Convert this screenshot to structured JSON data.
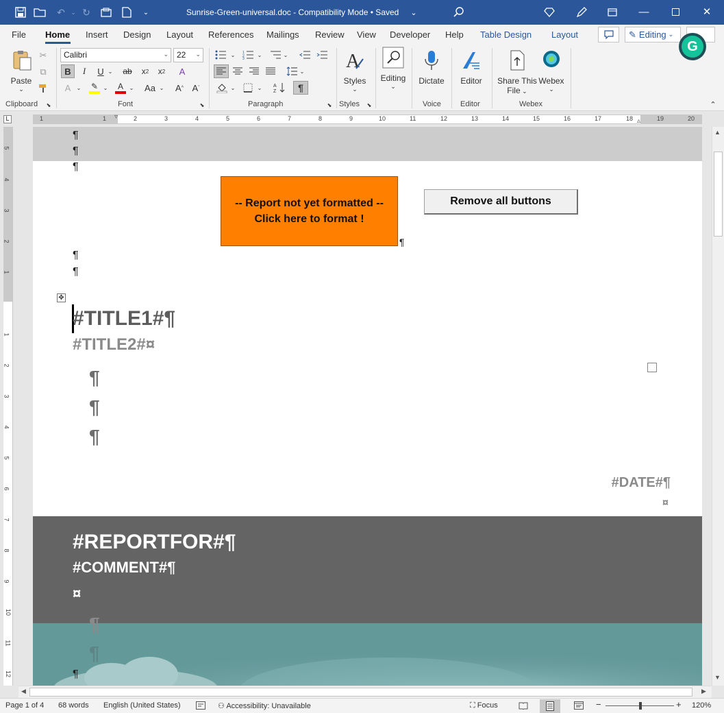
{
  "window": {
    "title": "Sunrise-Green-universal.doc  -  Compatibility Mode  •  Saved",
    "title_chevron": "⌄",
    "account_initial": "G"
  },
  "menu": {
    "file": "File",
    "home": "Home",
    "insert": "Insert",
    "design": "Design",
    "layout": "Layout",
    "references": "References",
    "mailings": "Mailings",
    "review": "Review",
    "view": "View",
    "developer": "Developer",
    "help": "Help",
    "table_design": "Table Design",
    "table_layout": "Layout",
    "editing_mode": "Editing"
  },
  "ribbon": {
    "paste": "Paste",
    "font_name": "Calibri",
    "font_size": "22",
    "styles": "Styles",
    "editing": "Editing",
    "dictate": "Dictate",
    "editor": "Editor",
    "share_line1": "Share This",
    "share_line2": "File",
    "webex": "Webex",
    "groups": {
      "clipboard": "Clipboard",
      "font": "Font",
      "paragraph": "Paragraph",
      "styles": "Styles",
      "voice": "Voice",
      "editor": "Editor",
      "webex": "Webex"
    }
  },
  "ruler": {
    "h_ticks": [
      "1",
      "1",
      "2",
      "3",
      "4",
      "5",
      "6",
      "7",
      "8",
      "9",
      "10",
      "11",
      "12",
      "13",
      "14",
      "15",
      "16",
      "17",
      "18",
      "19",
      "20"
    ],
    "v_ticks": [
      "5",
      "4",
      "3",
      "2",
      "1",
      "1",
      "2",
      "3",
      "4",
      "5",
      "6",
      "7",
      "8",
      "9",
      "10",
      "11",
      "12"
    ]
  },
  "document": {
    "pilcrow": "¶",
    "cell_end": "¤",
    "format_button_line1": "-- Report not yet formatted --",
    "format_button_line2": "Click here to format !",
    "remove_button": "Remove all buttons",
    "title1": "#TITLE1#¶",
    "title2": "#TITLE2#¤",
    "date": "#DATE#¶",
    "reportfor": "#REPORTFOR#¶",
    "comment": "#COMMENT#¶"
  },
  "status": {
    "page": "Page 1 of 4",
    "words": "68 words",
    "language": "English (United States)",
    "accessibility": "Accessibility: Unavailable",
    "focus": "Focus",
    "zoom": "120%"
  },
  "colors": {
    "title_bar": "#2b579a",
    "format_button": "#ff7f00",
    "dark_band": "#646464",
    "teal_band": "#64999a",
    "grammarly": "#15c39a"
  }
}
